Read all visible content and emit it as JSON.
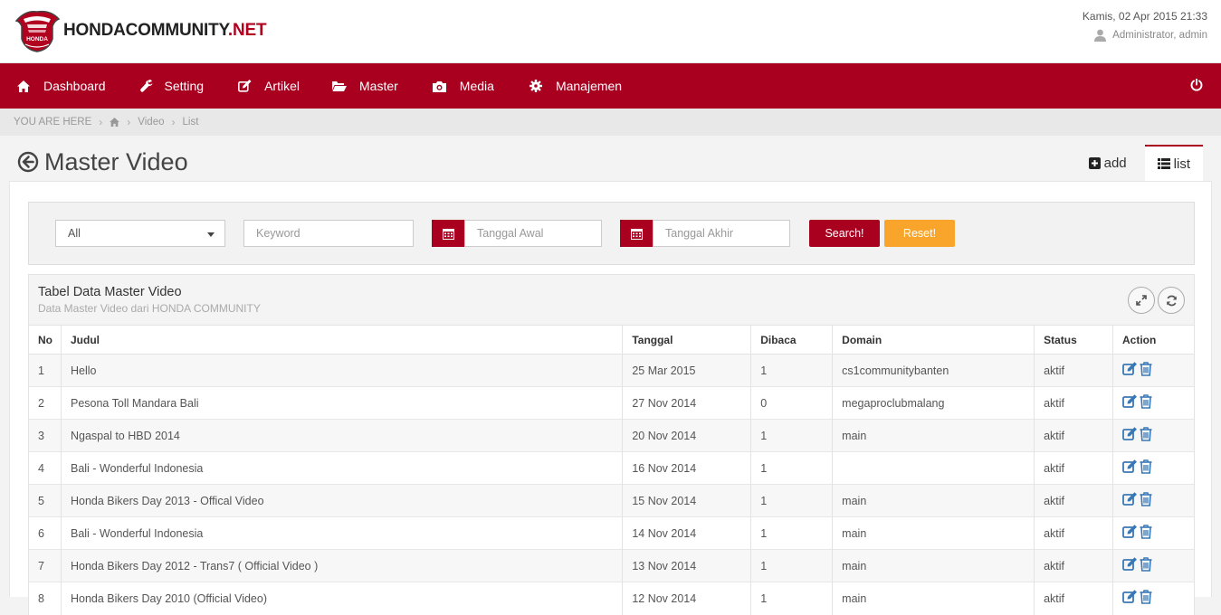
{
  "brand": {
    "name_main": "HONDACOMMUNITY",
    "name_tld": ".NET",
    "badge_text": "HONDA"
  },
  "header": {
    "datetime": "Kamis, 02 Apr 2015 21:33",
    "user": "Administrator, admin"
  },
  "nav": [
    {
      "label": "Dashboard",
      "icon": "home-icon"
    },
    {
      "label": "Setting",
      "icon": "wrench-icon"
    },
    {
      "label": "Artikel",
      "icon": "edit-icon"
    },
    {
      "label": "Master",
      "icon": "folder-open-icon"
    },
    {
      "label": "Media",
      "icon": "camera-icon"
    },
    {
      "label": "Manajemen",
      "icon": "gear-icon"
    }
  ],
  "breadcrumb": {
    "prefix": "YOU ARE HERE",
    "items": [
      "Video",
      "List"
    ]
  },
  "page": {
    "title": "Master Video"
  },
  "tabs": {
    "add": "add",
    "list": "list"
  },
  "filter": {
    "select_value": "All",
    "keyword_placeholder": "Keyword",
    "date_start_placeholder": "Tanggal Awal",
    "date_end_placeholder": "Tanggal Akhir",
    "search_label": "Search!",
    "reset_label": "Reset!"
  },
  "table": {
    "title": "Tabel Data Master Video",
    "subtitle": "Data Master Video dari HONDA COMMUNITY",
    "columns": [
      "No",
      "Judul",
      "Tanggal",
      "Dibaca",
      "Domain",
      "Status",
      "Action"
    ],
    "rows": [
      {
        "no": "1",
        "judul": "Hello",
        "tanggal": "25 Mar 2015",
        "dibaca": "1",
        "domain": "cs1communitybanten",
        "status": "aktif"
      },
      {
        "no": "2",
        "judul": "Pesona Toll Mandara Bali",
        "tanggal": "27 Nov 2014",
        "dibaca": "0",
        "domain": "megaproclubmalang",
        "status": "aktif"
      },
      {
        "no": "3",
        "judul": "Ngaspal to HBD 2014",
        "tanggal": "20 Nov 2014",
        "dibaca": "1",
        "domain": "main",
        "status": "aktif"
      },
      {
        "no": "4",
        "judul": "Bali - Wonderful Indonesia",
        "tanggal": "16 Nov 2014",
        "dibaca": "1",
        "domain": "",
        "status": "aktif"
      },
      {
        "no": "5",
        "judul": "Honda Bikers Day 2013 - Offical Video",
        "tanggal": "15 Nov 2014",
        "dibaca": "1",
        "domain": "main",
        "status": "aktif"
      },
      {
        "no": "6",
        "judul": "Bali - Wonderful Indonesia",
        "tanggal": "14 Nov 2014",
        "dibaca": "1",
        "domain": "main",
        "status": "aktif"
      },
      {
        "no": "7",
        "judul": "Honda Bikers Day 2012 - Trans7 ( Official Video )",
        "tanggal": "13 Nov 2014",
        "dibaca": "1",
        "domain": "main",
        "status": "aktif"
      },
      {
        "no": "8",
        "judul": "Honda Bikers Day 2010 (Official Video)",
        "tanggal": "12 Nov 2014",
        "dibaca": "1",
        "domain": "main",
        "status": "aktif"
      }
    ]
  },
  "colors": {
    "brand_red": "#a90020",
    "reset_orange": "#f9a52b",
    "action_blue": "#3a78b5"
  }
}
